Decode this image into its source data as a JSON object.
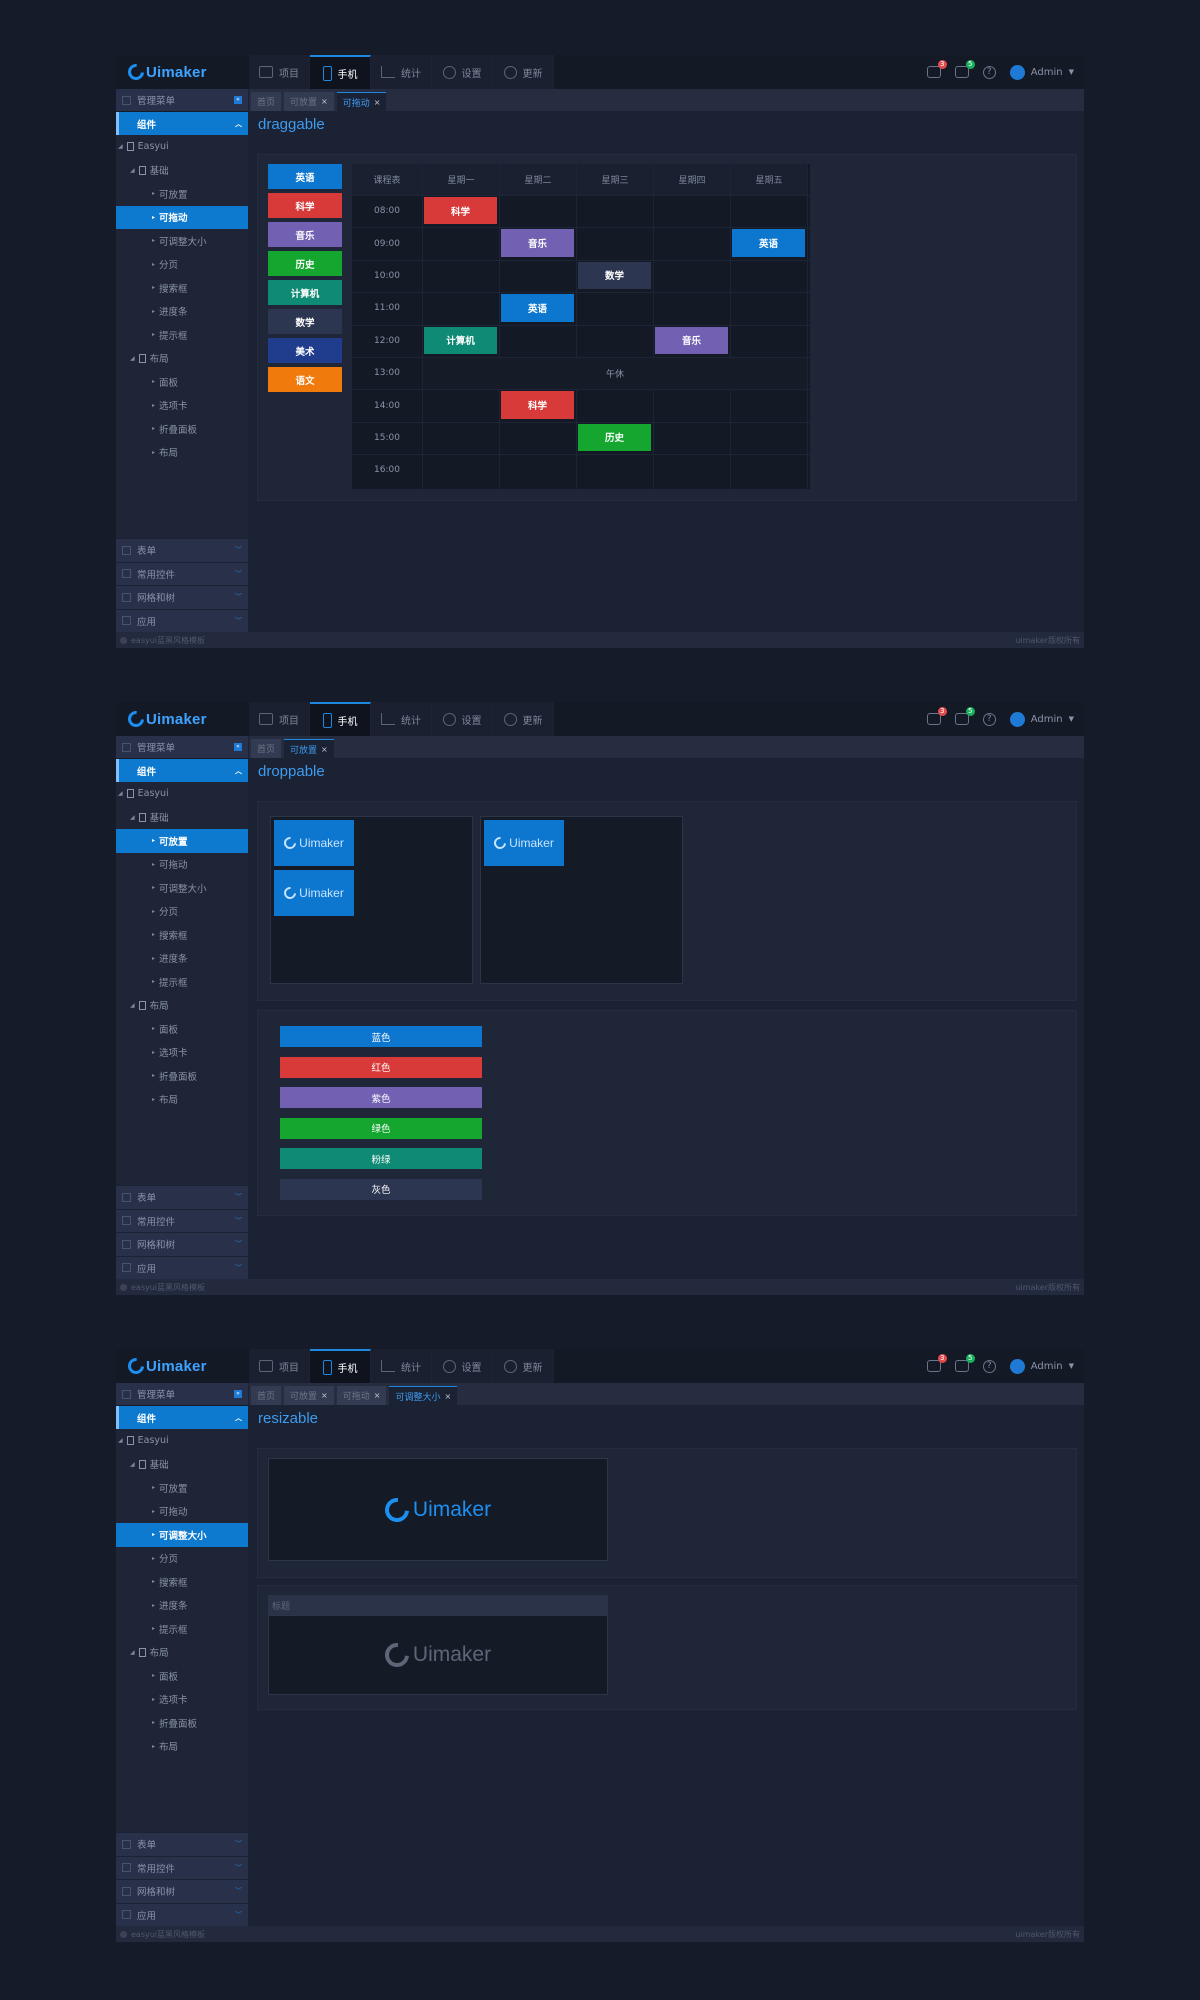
{
  "logo": "Uimaker",
  "nav": [
    "项目",
    "手机",
    "统计",
    "设置",
    "更新"
  ],
  "nav_active": "手机",
  "badges": {
    "chat": "3",
    "mail": "5"
  },
  "user": "Admin",
  "sidebar": {
    "header": "管理菜单",
    "group": "组件",
    "root": "Easyui",
    "basic": "基础",
    "basic_items": [
      "可放置",
      "可拖动",
      "可调整大小",
      "分页",
      "搜索框",
      "进度条",
      "提示框"
    ],
    "layout": "布局",
    "layout_items": [
      "面板",
      "选项卡",
      "折叠面板",
      "布局"
    ],
    "bottom": [
      "表单",
      "常用控件",
      "网格和树",
      "应用"
    ]
  },
  "status_left": "easyui蓝黑风格模板",
  "status_right": "uimaker版权所有",
  "home_tab": "首页",
  "screen1": {
    "tabs": [
      "首页",
      "可放置",
      "可拖动"
    ],
    "title": "draggable",
    "subjects": [
      {
        "name": "英语",
        "color": "#0d77cf"
      },
      {
        "name": "科学",
        "color": "#d83a3a"
      },
      {
        "name": "音乐",
        "color": "#7261b3"
      },
      {
        "name": "历史",
        "color": "#15a62f"
      },
      {
        "name": "计算机",
        "color": "#0f8a75"
      },
      {
        "name": "数学",
        "color": "#2d3650"
      },
      {
        "name": "美术",
        "color": "#1f3d8c"
      },
      {
        "name": "语文",
        "color": "#f07a0c"
      }
    ],
    "table_corner": "课程表",
    "days": [
      "星期一",
      "星期二",
      "星期三",
      "星期四",
      "星期五"
    ],
    "times": [
      "08:00",
      "09:00",
      "10:00",
      "11:00",
      "12:00",
      "13:00",
      "14:00",
      "15:00",
      "16:00"
    ],
    "lunch": "午休",
    "placed": [
      {
        "name": "科学",
        "row": 0,
        "col": 0,
        "color": "#d83a3a"
      },
      {
        "name": "音乐",
        "row": 1,
        "col": 1,
        "color": "#7261b3"
      },
      {
        "name": "英语",
        "row": 1,
        "col": 4,
        "color": "#0d77cf"
      },
      {
        "name": "数学",
        "row": 2,
        "col": 2,
        "color": "#2d3650"
      },
      {
        "name": "英语",
        "row": 3,
        "col": 1,
        "color": "#0d77cf"
      },
      {
        "name": "计算机",
        "row": 4,
        "col": 0,
        "color": "#0f8a75"
      },
      {
        "name": "音乐",
        "row": 4,
        "col": 3,
        "color": "#7261b3"
      },
      {
        "name": "科学",
        "row": 6,
        "col": 1,
        "color": "#d83a3a"
      },
      {
        "name": "历史",
        "row": 7,
        "col": 2,
        "color": "#15a62f"
      }
    ]
  },
  "screen2": {
    "tabs": [
      "首页",
      "可放置"
    ],
    "title": "droppable",
    "color_buttons": [
      {
        "label": "蓝色",
        "color": "#0d77cf"
      },
      {
        "label": "红色",
        "color": "#d83a3a"
      },
      {
        "label": "紫色",
        "color": "#7261b3"
      },
      {
        "label": "绿色",
        "color": "#15a62f"
      },
      {
        "label": "粉绿",
        "color": "#0f8a75"
      },
      {
        "label": "灰色",
        "color": "#2d3650"
      }
    ]
  },
  "screen3": {
    "tabs": [
      "首页",
      "可放置",
      "可拖动",
      "可调整大小"
    ],
    "title": "resizable",
    "panel_title": "标题"
  }
}
